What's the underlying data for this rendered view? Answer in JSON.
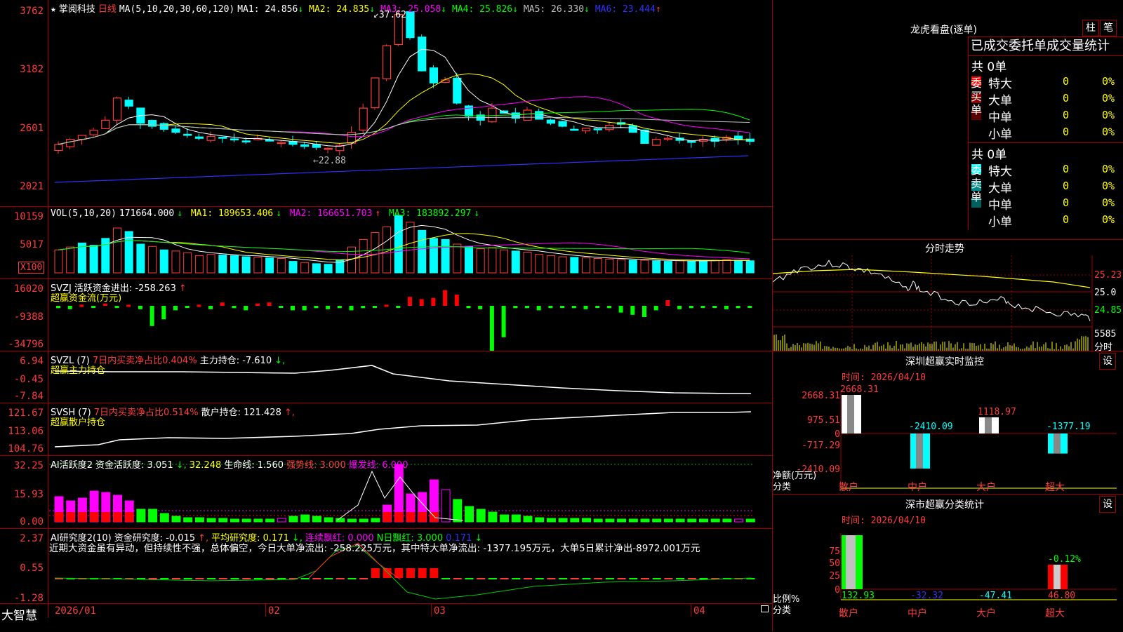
{
  "stock": {
    "name": "掌阅科技",
    "period": "日线",
    "ma_header": "MA(5,10,20,30,60,120)",
    "ma": [
      {
        "label": "MA1: 24.856",
        "arrow": "↓",
        "color": "#ffffff"
      },
      {
        "label": "MA2: 24.835",
        "arrow": "↓",
        "color": "#ffff00"
      },
      {
        "label": "MA3: 25.058",
        "arrow": "↓",
        "color": "#ff00ff"
      },
      {
        "label": "MA4: 25.826",
        "arrow": "↓",
        "color": "#00ff00"
      },
      {
        "label": "MA5: 26.330",
        "arrow": "↓",
        "color": "#c0c0c0"
      },
      {
        "label": "MA6: 23.444",
        "arrow": "↑",
        "color": "#3030ff"
      }
    ],
    "price_ticks": [
      "3762",
      "3182",
      "2601",
      "2021"
    ],
    "high_label": "37.62",
    "low_label": "22.88"
  },
  "vol": {
    "header": "VOL(5,10,20)",
    "value": "171664.000",
    "ma1": "MA1: 189653.406",
    "ma2": "MA2: 166651.703",
    "ma3": "MA3: 183892.297",
    "ticks": [
      "10159",
      "5017"
    ],
    "unit": "X100"
  },
  "svzj": {
    "header": "SVZJ",
    "label": "活跃资金进出: -258.263",
    "sub": "超赢资金流(万元)",
    "ticks": [
      "16020",
      "-9388",
      "-34796"
    ]
  },
  "svzl": {
    "header": "SVZL (7)",
    "ratio": "7日内买卖净占比0.404%",
    "label": "主力持仓: -7.610",
    "sub": "超赢主力持仓",
    "ticks": [
      "6.94",
      "-0.45",
      "-7.84"
    ]
  },
  "svsh": {
    "header": "SVSH (7)",
    "ratio": "7日内买卖净占比0.514%",
    "label": "散户持仓: 121.428",
    "sub": "超赢散户持仓",
    "ticks": [
      "121.67",
      "113.06",
      "104.76"
    ]
  },
  "ai1": {
    "header": "AI活跃度2",
    "label": "资金活跃度: 3.051",
    "v2": "32.248",
    "life": "生命线: 1.560",
    "strong": "强势线: 3.000",
    "burst": "爆发线: 6.000",
    "ticks": [
      "32.25",
      "15.93",
      "0.00"
    ]
  },
  "ai2": {
    "header": "AI研究度2(10)",
    "label": "资金研究度: -0.015",
    "avg": "平均研究度: 0.171",
    "red": "连续飘红: 0.000",
    "nred": "N日飘红: 3.000",
    "v5": "0.171",
    "note": "近期大资金虽有异动，但持续性不强，总体偏空，今日大单净流出: -258.225万元，其中特大单净流出: -1377.195万元，大单5日累计净出-8972.001万元",
    "ticks": [
      "2.37",
      "0.55",
      "-1.28"
    ]
  },
  "dates": [
    "2026/01",
    "02",
    "03",
    "04"
  ],
  "brand": "大智慧",
  "dragon": {
    "title": "龙虎看盘(逐单)",
    "btn1": "柱",
    "btn2": "笔",
    "tabs": "已成交委托单成交量统计",
    "buy": {
      "side": "委买单",
      "total": "共 0单",
      "rows": [
        {
          "name": "特大",
          "n": "0",
          "p": "0%"
        },
        {
          "name": "大单",
          "n": "0",
          "p": "0%"
        },
        {
          "name": "中单",
          "n": "0",
          "p": "0%"
        },
        {
          "name": "小单",
          "n": "0",
          "p": "0%"
        }
      ]
    },
    "sell": {
      "side": "委卖单",
      "total": "共 0单",
      "rows": [
        {
          "name": "特大",
          "n": "0",
          "p": "0%"
        },
        {
          "name": "大单",
          "n": "0",
          "p": "0%"
        },
        {
          "name": "中单",
          "n": "0",
          "p": "0%"
        },
        {
          "name": "小单",
          "n": "0",
          "p": "0%"
        }
      ]
    }
  },
  "intraday": {
    "title": "分时走势",
    "ticks": [
      "25.23",
      "25.0",
      "24.85"
    ],
    "vol_tick": "5585",
    "vol_label": "分时"
  },
  "monitor": {
    "title": "深圳超赢实时监控",
    "set": "设",
    "time": "时间: 2026/04/10",
    "ticks": [
      "2668.31",
      "975.51",
      "0",
      "-717.29",
      "-2410.09"
    ],
    "ylabel": "净额(万元)",
    "xlabel": "分类",
    "cats": [
      "散户",
      "中户",
      "大户",
      "超大"
    ],
    "values": [
      2668.31,
      -2410.09,
      1118.97,
      -1377.19
    ],
    "labels": [
      "2668.31",
      "-2410.09",
      "1118.97",
      "-1377.19"
    ]
  },
  "classify": {
    "title": "深市超赢分类统计",
    "set": "设",
    "time": "时间: 2026/04/10",
    "ticks": [
      "75",
      "50",
      "25",
      "0"
    ],
    "ylabel": "比例%",
    "xlabel": "分类",
    "cats": [
      "散户",
      "中户",
      "大户",
      "超大"
    ],
    "values": [
      "132.93",
      "-32.32",
      "-47.41",
      "46.80"
    ],
    "top_label": "-0.12%"
  }
}
